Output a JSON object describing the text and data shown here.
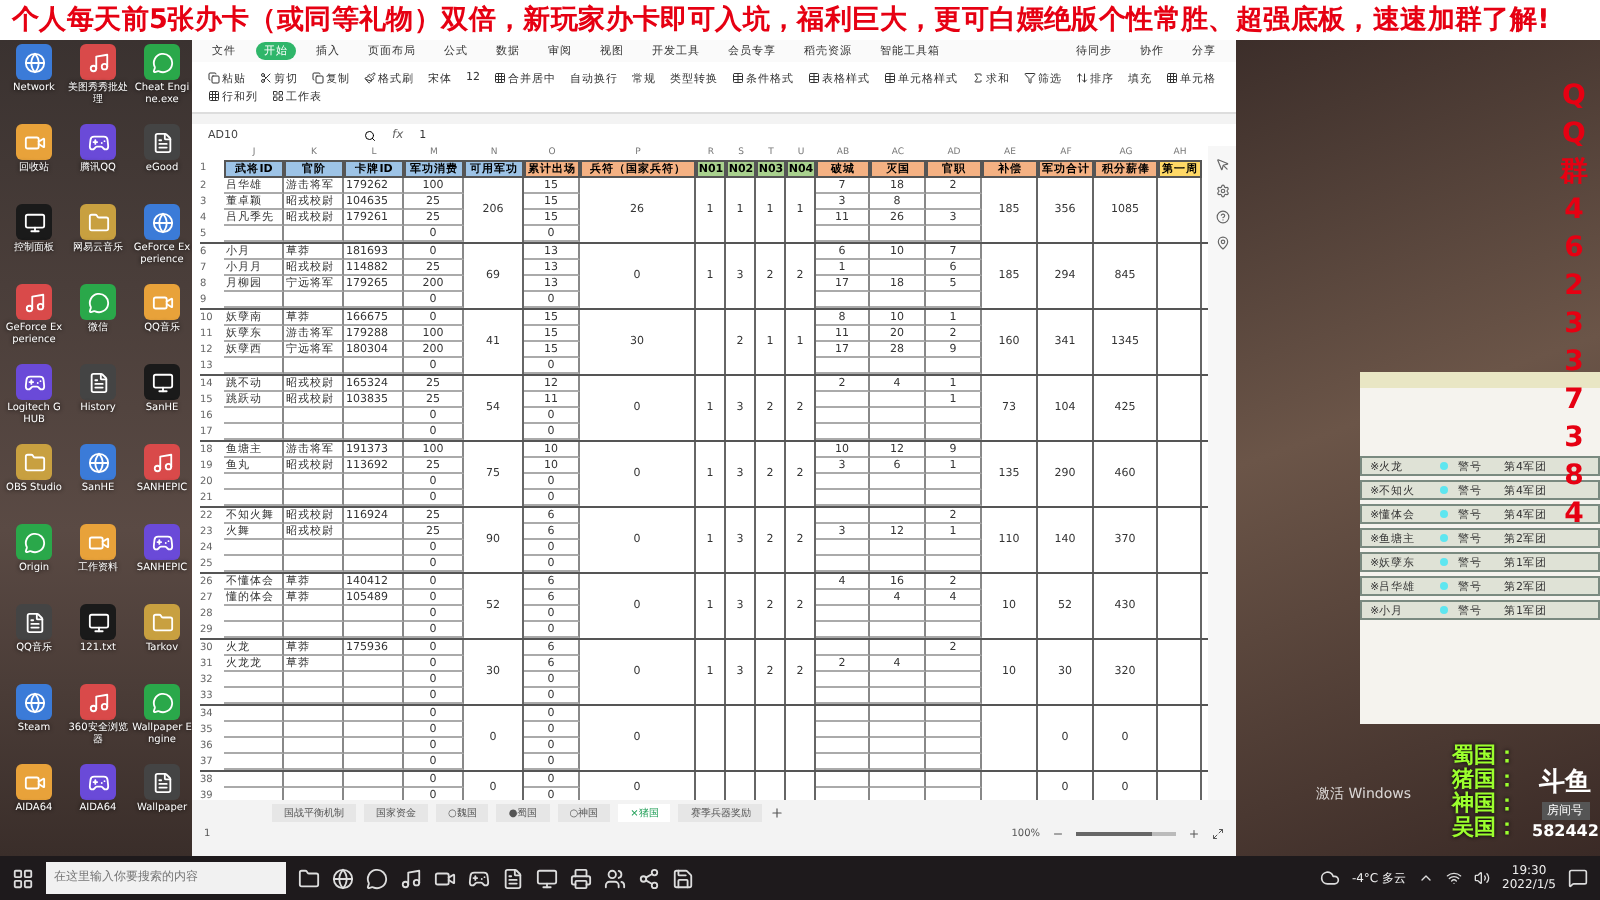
{
  "banner": {
    "text": "个人每天前5张办卡（或同等礼物）双倍，新玩家办卡即可入坑，福利巨大，更可白嫖绝版个性常胜、超强底板，速速加群了解!"
  },
  "desktop_icons": [
    {
      "label": "Network"
    },
    {
      "label": "美图秀秀批处理"
    },
    {
      "label": "Cheat Engine.exe"
    },
    {
      "label": "回收站"
    },
    {
      "label": "腾讯QQ"
    },
    {
      "label": "eGood"
    },
    {
      "label": "控制面板"
    },
    {
      "label": "网易云音乐"
    },
    {
      "label": "GeForce Experience"
    },
    {
      "label": "GeForce Experience"
    },
    {
      "label": "微信"
    },
    {
      "label": "QQ音乐"
    },
    {
      "label": "Logitech G HUB"
    },
    {
      "label": "History"
    },
    {
      "label": "SanHE"
    },
    {
      "label": "OBS Studio"
    },
    {
      "label": "SanHE"
    },
    {
      "label": "SANHEPIC"
    },
    {
      "label": "Origin"
    },
    {
      "label": "工作资料"
    },
    {
      "label": "SANHEPIC"
    },
    {
      "label": "QQ音乐"
    },
    {
      "label": "121.txt"
    },
    {
      "label": "Tarkov"
    },
    {
      "label": "Steam"
    },
    {
      "label": "360安全浏览器"
    },
    {
      "label": "Wallpaper Engine"
    },
    {
      "label": "AIDA64"
    },
    {
      "label": "AIDA64"
    },
    {
      "label": "Wallpaper"
    }
  ],
  "spreadsheet": {
    "menu": [
      {
        "label": "文件",
        "selected": false
      },
      {
        "label": "开始",
        "selected": true
      },
      {
        "label": "插入",
        "selected": false
      },
      {
        "label": "页面布局",
        "selected": false
      },
      {
        "label": "公式",
        "selected": false
      },
      {
        "label": "数据",
        "selected": false
      },
      {
        "label": "审阅",
        "selected": false
      },
      {
        "label": "视图",
        "selected": false
      },
      {
        "label": "开发工具",
        "selected": false
      },
      {
        "label": "会员专享",
        "selected": false
      },
      {
        "label": "稻壳资源",
        "selected": false
      },
      {
        "label": "智能工具箱",
        "selected": false
      }
    ],
    "menu_right": [
      "待同步",
      "协作",
      "分享"
    ],
    "ribbon": [
      "粘贴",
      "剪切",
      "复制",
      "格式刷",
      "宋体",
      "12",
      "合并居中",
      "自动换行",
      "常规",
      "类型转换",
      "条件格式",
      "表格样式",
      "单元格样式",
      "求和",
      "筛选",
      "排序",
      "填充",
      "单元格",
      "行和列",
      "工作表"
    ],
    "name_box": "AD10",
    "fx": "fx",
    "formula": "1",
    "header_row_num": "1",
    "columns": [
      {
        "letter": "J",
        "heading": "武将ID",
        "color": "#9dc3e6"
      },
      {
        "letter": "K",
        "heading": "官阶",
        "color": "#9dc3e6"
      },
      {
        "letter": "L",
        "heading": "卡牌ID",
        "color": "#9dc3e6"
      },
      {
        "letter": "M",
        "heading": "军功消费",
        "color": "#9dc3e6"
      },
      {
        "letter": "N",
        "heading": "可用军功",
        "color": "#9dc3e6"
      },
      {
        "letter": "O",
        "heading": "累计出场",
        "color": "#f4b183"
      },
      {
        "letter": "P",
        "heading": "兵符（国家兵符）",
        "color": "#f4b183"
      },
      {
        "letter": "R",
        "heading": "N01",
        "color": "#a9d18e"
      },
      {
        "letter": "S",
        "heading": "N02",
        "color": "#a9d18e"
      },
      {
        "letter": "T",
        "heading": "N03",
        "color": "#a9d18e"
      },
      {
        "letter": "U",
        "heading": "N04",
        "color": "#a9d18e"
      },
      {
        "letter": "AB",
        "heading": "破城",
        "color": "#f4b183"
      },
      {
        "letter": "AC",
        "heading": "灭国",
        "color": "#f4b183"
      },
      {
        "letter": "AD",
        "heading": "官职",
        "color": "#f4b183"
      },
      {
        "letter": "AE",
        "heading": "补偿",
        "color": "#f4b183"
      },
      {
        "letter": "AF",
        "heading": "军功合计",
        "color": "#f4b183"
      },
      {
        "letter": "AG",
        "heading": "积分薪俸",
        "color": "#f4b183"
      },
      {
        "letter": "AH",
        "heading": "第一周",
        "color": "#ffd966"
      }
    ],
    "groups": [
      {
        "merged": {
          "N": "206",
          "P": "26",
          "R": "1",
          "S": "1",
          "T": "1",
          "U": "1",
          "AE": "185",
          "AF": "356",
          "AG": "1085"
        },
        "rows": [
          {
            "num": "2",
            "cells": {
              "J": "吕华雄",
              "K": "游击将军",
              "L": "179262",
              "M": "100",
              "O": "15",
              "AB": "7",
              "AC": "18",
              "AD": "2"
            }
          },
          {
            "num": "3",
            "cells": {
              "J": "董卓颖",
              "K": "昭戎校尉",
              "L": "104635",
              "M": "25",
              "O": "15",
              "AB": "3",
              "AC": "8"
            }
          },
          {
            "num": "4",
            "cells": {
              "J": "吕凡季先",
              "K": "昭戎校尉",
              "L": "179261",
              "M": "25",
              "O": "15",
              "AB": "11",
              "AC": "26",
              "AD": "3"
            }
          },
          {
            "num": "5",
            "cells": {
              "M": "0",
              "O": "0"
            }
          }
        ]
      },
      {
        "merged": {
          "N": "69",
          "P": "0",
          "R": "1",
          "S": "3",
          "T": "2",
          "U": "2",
          "AE": "185",
          "AF": "294",
          "AG": "845"
        },
        "rows": [
          {
            "num": "6",
            "cells": {
              "J": "小月",
              "K": "草莽",
              "L": "181693",
              "M": "0",
              "O": "13",
              "AB": "6",
              "AC": "10",
              "AD": "7"
            }
          },
          {
            "num": "7",
            "cells": {
              "J": "小月月",
              "K": "昭戎校尉",
              "L": "114882",
              "M": "25",
              "O": "13",
              "AB": "1",
              "AD": "6"
            }
          },
          {
            "num": "8",
            "cells": {
              "J": "月柳园",
              "K": "宁远将军",
              "L": "179265",
              "M": "200",
              "O": "13",
              "AB": "17",
              "AC": "18",
              "AD": "5"
            }
          },
          {
            "num": "9",
            "cells": {
              "M": "0",
              "O": "0"
            }
          }
        ]
      },
      {
        "merged": {
          "N": "41",
          "P": "30",
          "S": "2",
          "T": "1",
          "U": "1",
          "AE": "160",
          "AF": "341",
          "AG": "1345"
        },
        "rows": [
          {
            "num": "10",
            "cells": {
              "J": "妖孽南",
              "K": "草莽",
              "L": "166675",
              "M": "0",
              "O": "15",
              "AB": "8",
              "AC": "10",
              "AD": "1"
            }
          },
          {
            "num": "11",
            "cells": {
              "J": "妖孽东",
              "K": "游击将军",
              "L": "179288",
              "M": "100",
              "O": "15",
              "AB": "11",
              "AC": "20",
              "AD": "2"
            }
          },
          {
            "num": "12",
            "cells": {
              "J": "妖孽西",
              "K": "宁远将军",
              "L": "180304",
              "M": "200",
              "O": "15",
              "AB": "17",
              "AC": "28",
              "AD": "9"
            }
          },
          {
            "num": "13",
            "cells": {
              "M": "0",
              "O": "0"
            }
          }
        ]
      },
      {
        "merged": {
          "N": "54",
          "P": "0",
          "R": "1",
          "S": "3",
          "T": "2",
          "U": "2",
          "AE": "73",
          "AF": "104",
          "AG": "425"
        },
        "rows": [
          {
            "num": "14",
            "cells": {
              "J": "跳不动",
              "K": "昭戎校尉",
              "L": "165324",
              "M": "25",
              "O": "12",
              "AB": "2",
              "AC": "4",
              "AD": "1"
            }
          },
          {
            "num": "15",
            "cells": {
              "J": "跳跃动",
              "K": "昭戎校尉",
              "L": "103835",
              "M": "25",
              "O": "11",
              "AD": "1"
            }
          },
          {
            "num": "16",
            "cells": {
              "M": "0",
              "O": "0"
            }
          },
          {
            "num": "17",
            "cells": {
              "M": "0",
              "O": "0"
            }
          }
        ]
      },
      {
        "merged": {
          "N": "75",
          "P": "0",
          "R": "1",
          "S": "3",
          "T": "2",
          "U": "2",
          "AE": "135",
          "AF": "290",
          "AG": "460"
        },
        "rows": [
          {
            "num": "18",
            "cells": {
              "J": "鱼塘主",
              "K": "游击将军",
              "L": "191373",
              "M": "100",
              "O": "10",
              "AB": "10",
              "AC": "12",
              "AD": "9"
            }
          },
          {
            "num": "19",
            "cells": {
              "J": "鱼丸",
              "K": "昭戎校尉",
              "L": "113692",
              "M": "25",
              "O": "10",
              "AB": "3",
              "AC": "6",
              "AD": "1"
            }
          },
          {
            "num": "20",
            "cells": {
              "M": "0",
              "O": "0"
            }
          },
          {
            "num": "21",
            "cells": {
              "M": "0",
              "O": "0"
            }
          }
        ]
      },
      {
        "merged": {
          "N": "90",
          "P": "0",
          "R": "1",
          "S": "3",
          "T": "2",
          "U": "2",
          "AE": "110",
          "AF": "140",
          "AG": "370"
        },
        "rows": [
          {
            "num": "22",
            "cells": {
              "J": "不知火舞",
              "K": "昭戎校尉",
              "L": "116924",
              "M": "25",
              "O": "6",
              "AD": "2"
            }
          },
          {
            "num": "23",
            "cells": {
              "J": "火舞",
              "K": "昭戎校尉",
              "M": "25",
              "O": "6",
              "AB": "3",
              "AC": "12",
              "AD": "1"
            }
          },
          {
            "num": "24",
            "cells": {
              "M": "0",
              "O": "0"
            }
          },
          {
            "num": "25",
            "cells": {
              "M": "0",
              "O": "0"
            }
          }
        ]
      },
      {
        "merged": {
          "N": "52",
          "P": "0",
          "R": "1",
          "S": "3",
          "T": "2",
          "U": "2",
          "AE": "10",
          "AF": "52",
          "AG": "430"
        },
        "rows": [
          {
            "num": "26",
            "cells": {
              "J": "不懂体会",
              "K": "草莽",
              "L": "140412",
              "M": "0",
              "O": "6",
              "AB": "4",
              "AC": "16",
              "AD": "2"
            }
          },
          {
            "num": "27",
            "cells": {
              "J": "懂的体会",
              "K": "草莽",
              "L": "105489",
              "M": "0",
              "O": "6",
              "AC": "4",
              "AD": "4"
            }
          },
          {
            "num": "28",
            "cells": {
              "M": "0",
              "O": "0"
            }
          },
          {
            "num": "29",
            "cells": {
              "M": "0",
              "O": "0"
            }
          }
        ]
      },
      {
        "merged": {
          "N": "30",
          "P": "0",
          "R": "1",
          "S": "3",
          "T": "2",
          "U": "2",
          "AE": "10",
          "AF": "30",
          "AG": "320"
        },
        "rows": [
          {
            "num": "30",
            "cells": {
              "J": "火龙",
              "K": "草莽",
              "L": "175936",
              "M": "0",
              "O": "6",
              "AD": "2"
            }
          },
          {
            "num": "31",
            "cells": {
              "J": "火龙龙",
              "K": "草莽",
              "M": "0",
              "O": "6",
              "AB": "2",
              "AC": "4"
            }
          },
          {
            "num": "32",
            "cells": {
              "M": "0",
              "O": "0"
            }
          },
          {
            "num": "33",
            "cells": {
              "M": "0",
              "O": "0"
            }
          }
        ]
      },
      {
        "merged": {
          "N": "0",
          "P": "0",
          "AF": "0",
          "AG": "0"
        },
        "rows": [
          {
            "num": "34",
            "cells": {
              "M": "0",
              "O": "0"
            }
          },
          {
            "num": "35",
            "cells": {
              "M": "0",
              "O": "0"
            }
          },
          {
            "num": "36",
            "cells": {
              "M": "0",
              "O": "0"
            }
          },
          {
            "num": "37",
            "cells": {
              "M": "0",
              "O": "0"
            }
          }
        ]
      },
      {
        "merged": {
          "N": "0",
          "P": "0",
          "AF": "0",
          "AG": "0"
        },
        "rows": [
          {
            "num": "38",
            "cells": {
              "M": "0",
              "O": "0"
            }
          },
          {
            "num": "39",
            "cells": {
              "M": "0",
              "O": "0"
            }
          }
        ]
      }
    ],
    "sheet_tabs": [
      {
        "label": "国战平衡机制",
        "selected": false
      },
      {
        "label": "国家资金",
        "selected": false
      },
      {
        "label": "○魏国",
        "selected": false
      },
      {
        "label": "●蜀国",
        "selected": false
      },
      {
        "label": "○神国",
        "selected": false
      },
      {
        "label": "×猪国",
        "selected": true
      },
      {
        "label": "赛季兵器奖励",
        "selected": false
      }
    ],
    "status": "1",
    "zoom": "100%",
    "zoom_slider": {
      "level": 0.75
    }
  },
  "qq_column": [
    "Q",
    "Q",
    "群",
    "4",
    "6",
    "2",
    "3",
    "3",
    "7",
    "3",
    "8",
    "4"
  ],
  "overlay_panel": {
    "rows": [
      {
        "name": "※火龙",
        "tag": "警号",
        "corps": "第4军团",
        "color": "#5ee6f0"
      },
      {
        "name": "※不知火",
        "tag": "警号",
        "corps": "第4军团",
        "color": "#5ee6f0"
      },
      {
        "name": "※懂体会",
        "tag": "警号",
        "corps": "第4军团",
        "color": "#5ee6f0"
      },
      {
        "name": "※鱼塘主",
        "tag": "警号",
        "corps": "第2军团",
        "color": "#5ee6f0"
      },
      {
        "name": "※妖孽东",
        "tag": "警号",
        "corps": "第1军团",
        "color": "#5ee6f0"
      },
      {
        "name": "※吕华雄",
        "tag": "警号",
        "corps": "第2军团",
        "color": "#5ee6f0"
      },
      {
        "name": "※小月",
        "tag": "警号",
        "corps": "第1军团",
        "color": "#5ee6f0"
      }
    ]
  },
  "nations": [
    "蜀国：",
    "猪国：",
    "神国：",
    "吴国："
  ],
  "activation": "激活 Windows",
  "stream_logo": {
    "name": "斗鱼",
    "room_label": "房间号",
    "room": "582442"
  },
  "taskbar": {
    "search_placeholder": "在这里输入你要搜索的内容",
    "weather": "-4°C 多云",
    "time": "19:30",
    "date": "2022/1/5"
  }
}
